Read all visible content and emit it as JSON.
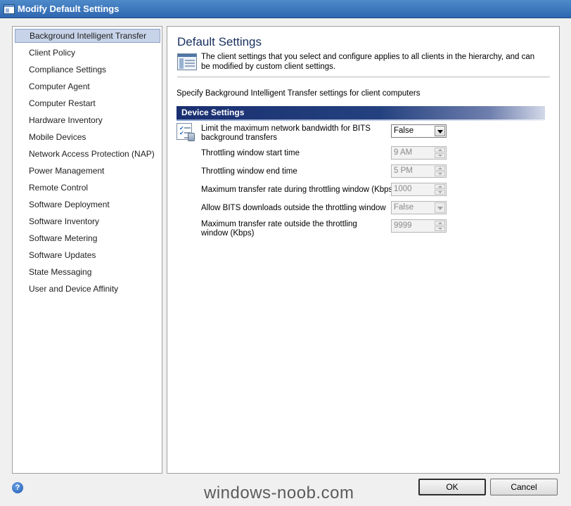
{
  "window": {
    "title": "Modify Default Settings"
  },
  "sidebar": {
    "items": [
      {
        "label": "Background Intelligent Transfer",
        "selected": true
      },
      {
        "label": "Client Policy"
      },
      {
        "label": "Compliance Settings"
      },
      {
        "label": "Computer Agent"
      },
      {
        "label": "Computer Restart"
      },
      {
        "label": "Hardware Inventory"
      },
      {
        "label": "Mobile Devices"
      },
      {
        "label": "Network Access Protection (NAP)"
      },
      {
        "label": "Power Management"
      },
      {
        "label": "Remote Control"
      },
      {
        "label": "Software Deployment"
      },
      {
        "label": "Software Inventory"
      },
      {
        "label": "Software Metering"
      },
      {
        "label": "Software Updates"
      },
      {
        "label": "State Messaging"
      },
      {
        "label": "User and Device Affinity"
      }
    ]
  },
  "main": {
    "title": "Default Settings",
    "description": "The client settings that you select and configure applies to all clients in the hierarchy, and can be modified by custom client settings.",
    "subtitle": "Specify Background Intelligent Transfer settings for client computers",
    "group_title": "Device Settings",
    "settings": [
      {
        "label": "Limit the maximum network bandwidth for BITS background transfers",
        "value": "False",
        "control": "dropdown",
        "enabled": true
      },
      {
        "label": "Throttling window start time",
        "value": "9 AM",
        "control": "spinner",
        "enabled": false
      },
      {
        "label": "Throttling window end time",
        "value": "5 PM",
        "control": "spinner",
        "enabled": false
      },
      {
        "label": "Maximum transfer rate during throttling window (Kbps)",
        "value": "1000",
        "control": "spinner",
        "enabled": false
      },
      {
        "label": "Allow BITS downloads outside the throttling window",
        "value": "False",
        "control": "dropdown",
        "enabled": false
      },
      {
        "label": "Maximum transfer rate outside the throttling window (Kbps)",
        "value": "9999",
        "control": "spinner",
        "enabled": false
      }
    ]
  },
  "footer": {
    "help_label": "?",
    "watermark": "windows-noob.com",
    "ok_label": "OK",
    "cancel_label": "Cancel"
  },
  "colors": {
    "title_bar": "#2e67b1",
    "group_header": "#1a2f71",
    "selection": "#c7d3e8"
  }
}
